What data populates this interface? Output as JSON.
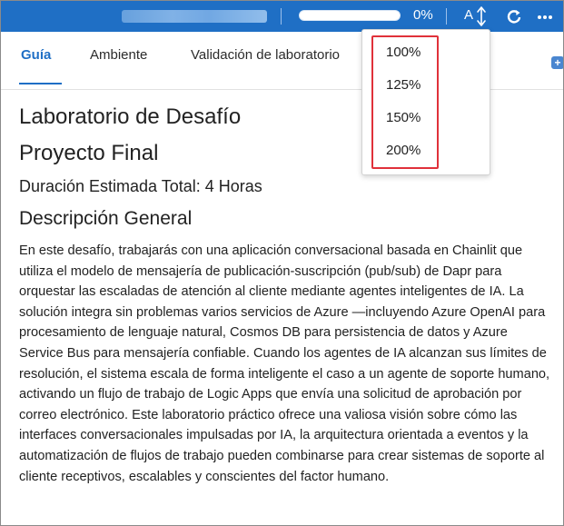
{
  "topbar": {
    "progress_percent": 0,
    "progress_text": "0%",
    "font_size_letter": "A",
    "icons": [
      "font-size-icon",
      "refresh-icon",
      "more-icon"
    ],
    "bar_color": "#1f6fc5"
  },
  "tabs": [
    {
      "label": "Guía",
      "active": true
    },
    {
      "label": "Ambiente",
      "active": false
    },
    {
      "label": "Validación de laboratorio",
      "active": false
    }
  ],
  "zoom_menu": {
    "options": [
      "100%",
      "125%",
      "150%",
      "200%"
    ],
    "highlight_color": "#e0313a"
  },
  "content": {
    "title": "Laboratorio de Desafío",
    "subtitle": "Proyecto Final",
    "duration": "Duración Estimada Total: 4 Horas",
    "section_heading": "Descripción General",
    "paragraph": "En este desafío, trabajarás con una aplicación conversacional basada en Chainlit que utiliza el modelo de mensajería de publicación-suscripción (pub/sub) de Dapr para orquestar las escaladas de atención al cliente mediante agentes inteligentes de IA. La solución integra sin problemas varios servicios de Azure —incluyendo Azure OpenAI para procesamiento de lenguaje natural, Cosmos DB para persistencia de datos y Azure Service Bus para mensajería confiable. Cuando los agentes de IA alcanzan sus límites de resolución, el sistema escala de forma inteligente el caso a un agente de soporte humano, activando un flujo de trabajo de Logic Apps que envía una solicitud de aprobación por correo electrónico. Este laboratorio práctico ofrece una valiosa visión sobre cómo las interfaces conversacionales impulsadas por IA, la arquitectura orientada a eventos y la automatización de flujos de trabajo pueden combinarse para crear sistemas de soporte al cliente receptivos, escalables y conscientes del factor humano."
  }
}
